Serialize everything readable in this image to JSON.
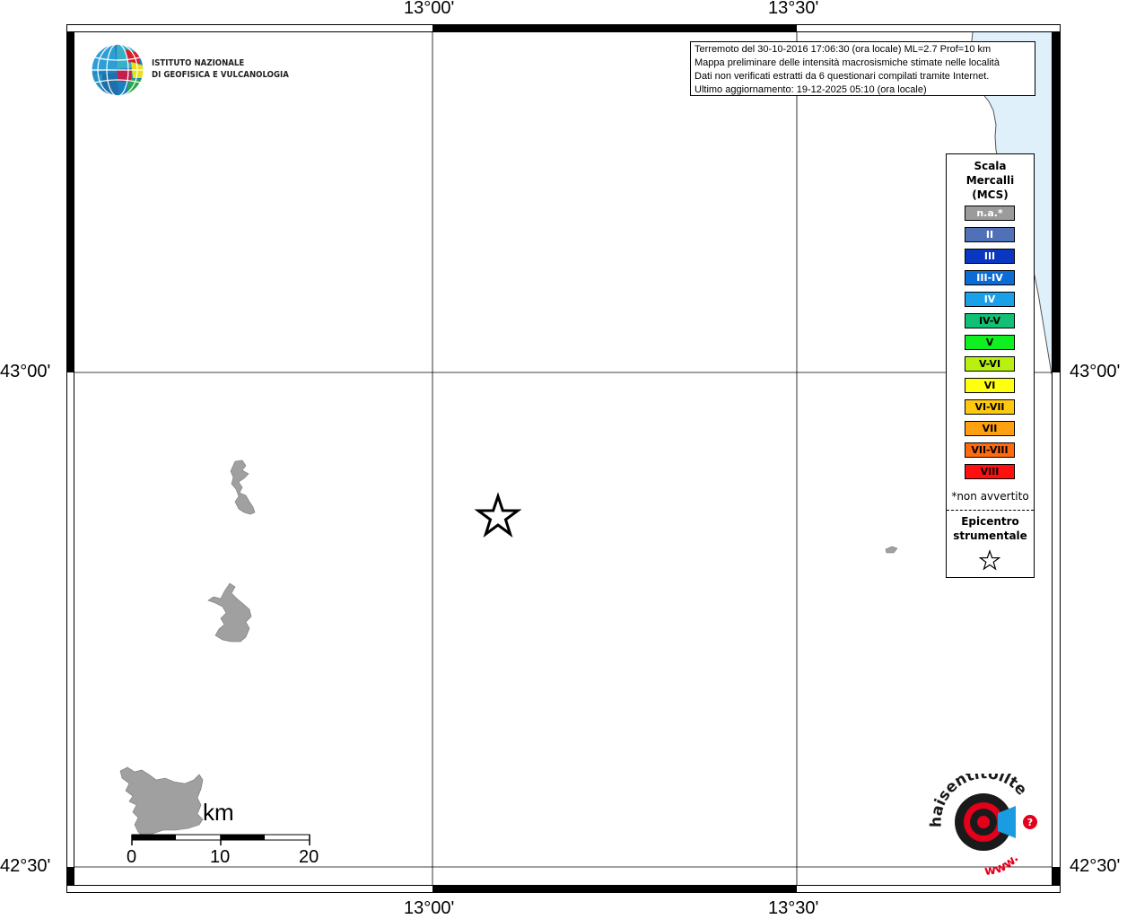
{
  "axes": {
    "top_labels": [
      "13°00'",
      "13°30'"
    ],
    "bottom_labels": [
      "13°00'",
      "13°30'"
    ],
    "left_labels": [
      "43°00'",
      "42°30'"
    ],
    "right_labels": [
      "43°00'",
      "42°30'"
    ]
  },
  "info": {
    "line1": "Terremoto del 30-10-2016 17:06:30 (ora locale) ML=2.7 Prof=10 km",
    "line2": "Mappa preliminare delle intensità macrosismiche stimate nelle località",
    "line3": "Dati non verificati estratti da 6 questionari compilati tramite Internet.",
    "line4": "Ultimo aggiornamento: 19-12-2025 05:10 (ora locale)"
  },
  "logo": {
    "line1": "ISTITUTO NAZIONALE",
    "line2": "DI GEOFISICA E VULCANOLOGIA"
  },
  "legend": {
    "title1": "Scala",
    "title2": "Mercalli",
    "title3": "(MCS)",
    "items": [
      {
        "label": "n.a.*",
        "color": "#9b9b9b",
        "text_color": "#ffffff"
      },
      {
        "label": "II",
        "color": "#5070b8",
        "text_color": "#ffffff"
      },
      {
        "label": "III",
        "color": "#0a37c0",
        "text_color": "#ffffff"
      },
      {
        "label": "III-IV",
        "color": "#0c6cd6",
        "text_color": "#ffffff"
      },
      {
        "label": "IV",
        "color": "#1aa0e8",
        "text_color": "#ffffff"
      },
      {
        "label": "IV-V",
        "color": "#10c074",
        "text_color": "#000000"
      },
      {
        "label": "V",
        "color": "#10ef20",
        "text_color": "#000000"
      },
      {
        "label": "V-VI",
        "color": "#b8f010",
        "text_color": "#000000"
      },
      {
        "label": "VI",
        "color": "#ffff10",
        "text_color": "#000000"
      },
      {
        "label": "VI-VII",
        "color": "#ffc810",
        "text_color": "#000000"
      },
      {
        "label": "VII",
        "color": "#ffa010",
        "text_color": "#000000"
      },
      {
        "label": "VII-VIII",
        "color": "#ff6a10",
        "text_color": "#000000"
      },
      {
        "label": "VIII",
        "color": "#ff1010",
        "text_color": "#000000"
      }
    ],
    "note": "*non avvertito",
    "epicenter1": "Epicentro",
    "epicenter2": "strumentale"
  },
  "scalebar": {
    "unit": "km",
    "labels": [
      "0",
      "10",
      "20"
    ]
  },
  "watermark": {
    "text_main": "haisentitoilterremoto.it",
    "text_www": "www."
  },
  "colors": {
    "sea": "#dff0fb",
    "lake": "#a0a0a0",
    "frame": "#000000"
  }
}
